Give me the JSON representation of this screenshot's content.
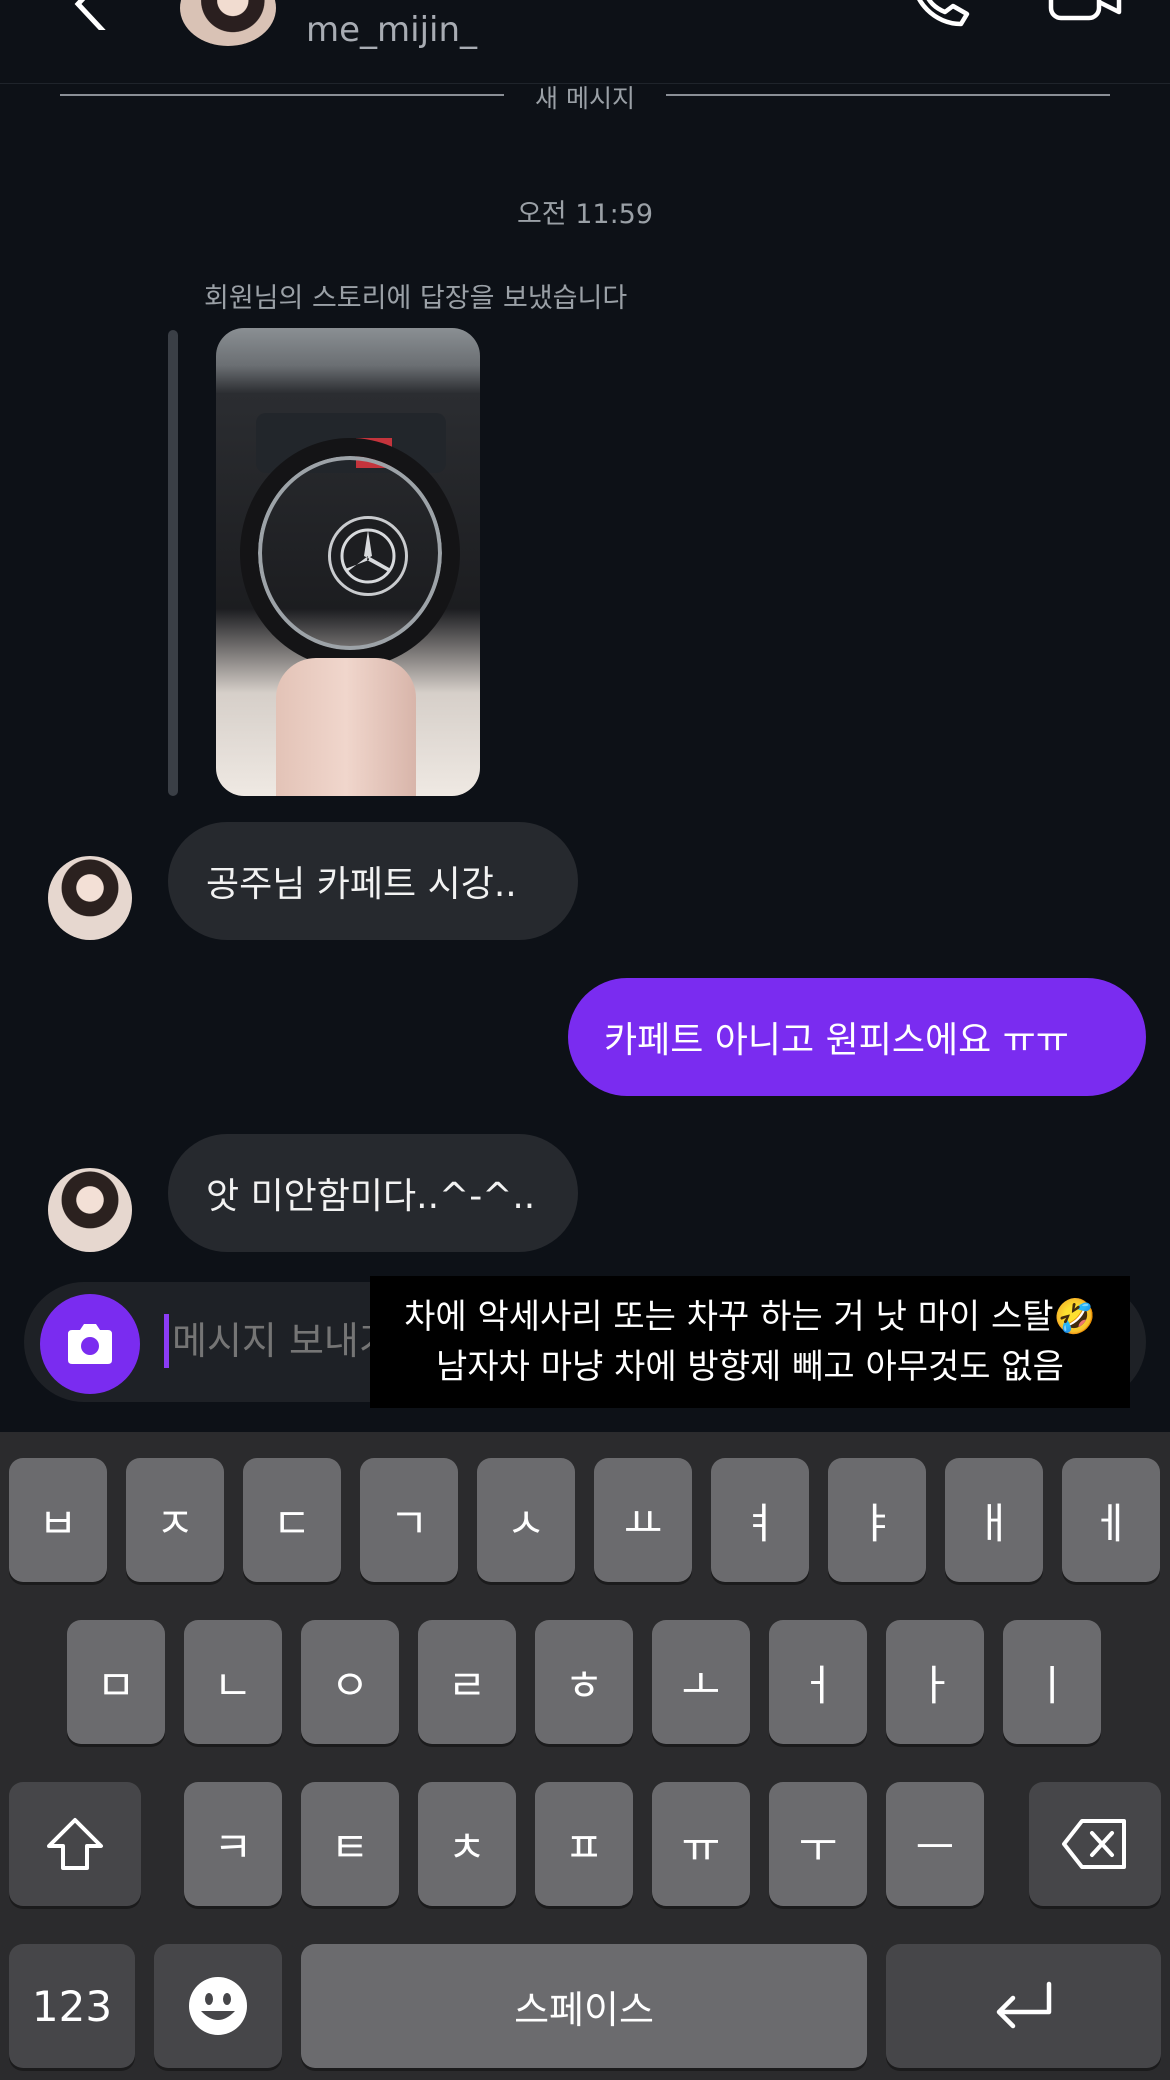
{
  "header": {
    "username": "me_mijin_"
  },
  "divider": {
    "label": "새 메시지"
  },
  "timestamp": "오전 11:59",
  "story_reply": {
    "note": "회원님의 스토리에 답장을 보냈습니다"
  },
  "messages": [
    {
      "from": "them",
      "text": "공주님 카페트 시강.."
    },
    {
      "from": "me",
      "text": "카페트 아니고 원피스에요 ㅠㅠ"
    },
    {
      "from": "them",
      "text": "앗 미안함미다..^-^.."
    }
  ],
  "composer": {
    "placeholder": "메시지 보내기..."
  },
  "caption": {
    "line1": "차에 악세사리 또는 차꾸 하는 거 낫 마이 스탈🤣",
    "line2": "남자차 마냥 차에 방향제 빼고 아무것도 없음"
  },
  "keyboard": {
    "row1": [
      "ㅂ",
      "ㅈ",
      "ㄷ",
      "ㄱ",
      "ㅅ",
      "ㅛ",
      "ㅕ",
      "ㅑ",
      "ㅐ",
      "ㅔ"
    ],
    "row2": [
      "ㅁ",
      "ㄴ",
      "ㅇ",
      "ㄹ",
      "ㅎ",
      "ㅗ",
      "ㅓ",
      "ㅏ",
      "ㅣ"
    ],
    "row3": [
      "ㅋ",
      "ㅌ",
      "ㅊ",
      "ㅍ",
      "ㅠ",
      "ㅜ",
      "ㅡ"
    ],
    "numbers_label": "123",
    "space_label": "스페이스"
  },
  "colors": {
    "background": "#0d1117",
    "accent": "#7a2cf0",
    "bubble_in": "#26292e"
  }
}
